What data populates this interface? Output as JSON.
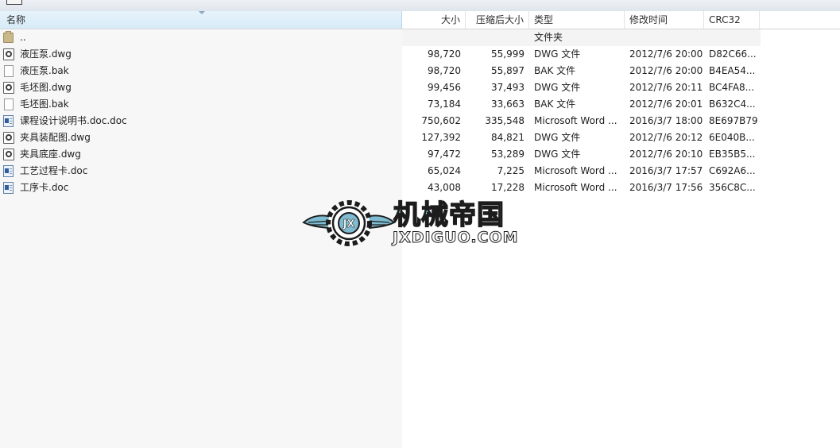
{
  "columns": {
    "name": "名称",
    "size": "大小",
    "packed": "压缩后大小",
    "type": "类型",
    "modified": "修改时间",
    "crc": "CRC32"
  },
  "parent_row": {
    "name": "..",
    "type": "文件夹"
  },
  "files": [
    {
      "icon": "dwg-file-icon",
      "name": "液压泵.dwg",
      "size": "98,720",
      "packed": "55,999",
      "type": "DWG 文件",
      "modified": "2012/7/6 20:00",
      "crc": "D82C66..."
    },
    {
      "icon": "bak-file-icon",
      "name": "液压泵.bak",
      "size": "98,720",
      "packed": "55,897",
      "type": "BAK 文件",
      "modified": "2012/7/6 20:00",
      "crc": "B4EA54..."
    },
    {
      "icon": "dwg-file-icon",
      "name": "毛坯图.dwg",
      "size": "99,456",
      "packed": "37,493",
      "type": "DWG 文件",
      "modified": "2012/7/6 20:11",
      "crc": "BC4FA8..."
    },
    {
      "icon": "bak-file-icon",
      "name": "毛坯图.bak",
      "size": "73,184",
      "packed": "33,663",
      "type": "BAK 文件",
      "modified": "2012/7/6 20:01",
      "crc": "B632C4..."
    },
    {
      "icon": "doc-file-icon",
      "name": "课程设计说明书.doc.doc",
      "size": "750,602",
      "packed": "335,548",
      "type": "Microsoft Word ...",
      "modified": "2016/3/7 18:00",
      "crc": "8E697B79"
    },
    {
      "icon": "dwg-file-icon",
      "name": "夹具装配图.dwg",
      "size": "127,392",
      "packed": "84,821",
      "type": "DWG 文件",
      "modified": "2012/7/6 20:12",
      "crc": "6E040B..."
    },
    {
      "icon": "dwg-file-icon",
      "name": "夹具底座.dwg",
      "size": "97,472",
      "packed": "53,289",
      "type": "DWG 文件",
      "modified": "2012/7/6 20:10",
      "crc": "EB35B5..."
    },
    {
      "icon": "doc-file-icon",
      "name": "工艺过程卡.doc",
      "size": "65,024",
      "packed": "7,225",
      "type": "Microsoft Word ...",
      "modified": "2016/3/7 17:57",
      "crc": "C692A6..."
    },
    {
      "icon": "doc-file-icon",
      "name": "工序卡.doc",
      "size": "43,008",
      "packed": "17,228",
      "type": "Microsoft Word ...",
      "modified": "2016/3/7 17:56",
      "crc": "356C8C..."
    }
  ],
  "watermark": {
    "title": "机械帝国",
    "subtitle": "JXDIGUO.COM",
    "emblem_text": "JX"
  },
  "colors": {
    "header_selected": "#d6ebf8",
    "watermark_blue": "#7fbcd1"
  }
}
